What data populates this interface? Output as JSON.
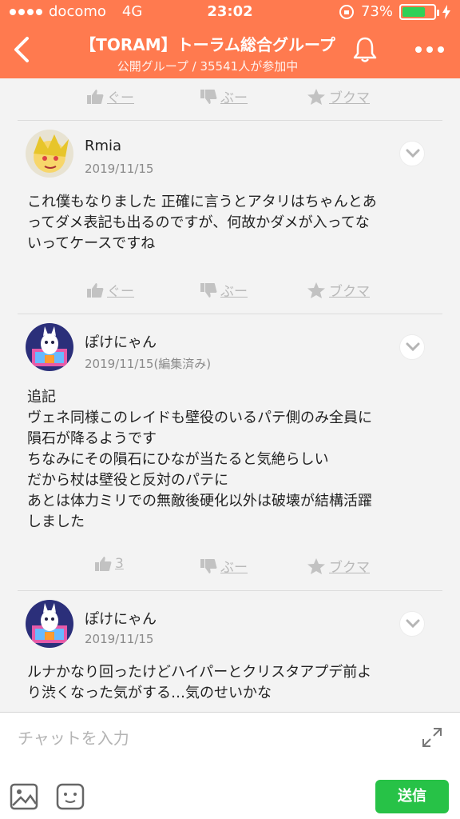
{
  "status": {
    "carrier": "docomo",
    "network": "4G",
    "time": "23:02",
    "battery": "73%",
    "battery_level": 0.73
  },
  "header": {
    "title": "【TORAM】トーラム総合グループ",
    "subtitle": "公開グループ / 35541人が参加中"
  },
  "reaction_labels": {
    "good": "ぐー",
    "boo": "ぶー",
    "bookmark": "ブクマ"
  },
  "posts": [
    {
      "author": "Rmia",
      "date": "2019/11/15",
      "text": "これ僕もなりました 正確に言うとアタリはちゃんとあ\nってダメ表記も出るのですが、何故かダメが入ってな\nいってケースですね",
      "good": "ぐー"
    },
    {
      "author": "ぽけにゃん",
      "date": "2019/11/15(編集済み)",
      "text": "追記\nヴェネ同様このレイドも壁役のいるパテ側のみ全員に\n隕石が降るようです\nちなみにその隕石にひなが当たると気絶らしい\nだから杖は壁役と反対のパテに\nあとは体力ミリでの無敵後硬化以外は破壊が結構活躍\nしました",
      "good": "3"
    },
    {
      "author": "ぽけにゃん",
      "date": "2019/11/15",
      "text": "ルナかなり回ったけどハイパーとクリスタアプデ前よ\nり渋くなった気がする…気のせいかな"
    }
  ],
  "composer": {
    "placeholder": "チャットを入力",
    "send_label": "送信"
  },
  "colors": {
    "header": "#ff7a4f",
    "send": "#27c247"
  }
}
